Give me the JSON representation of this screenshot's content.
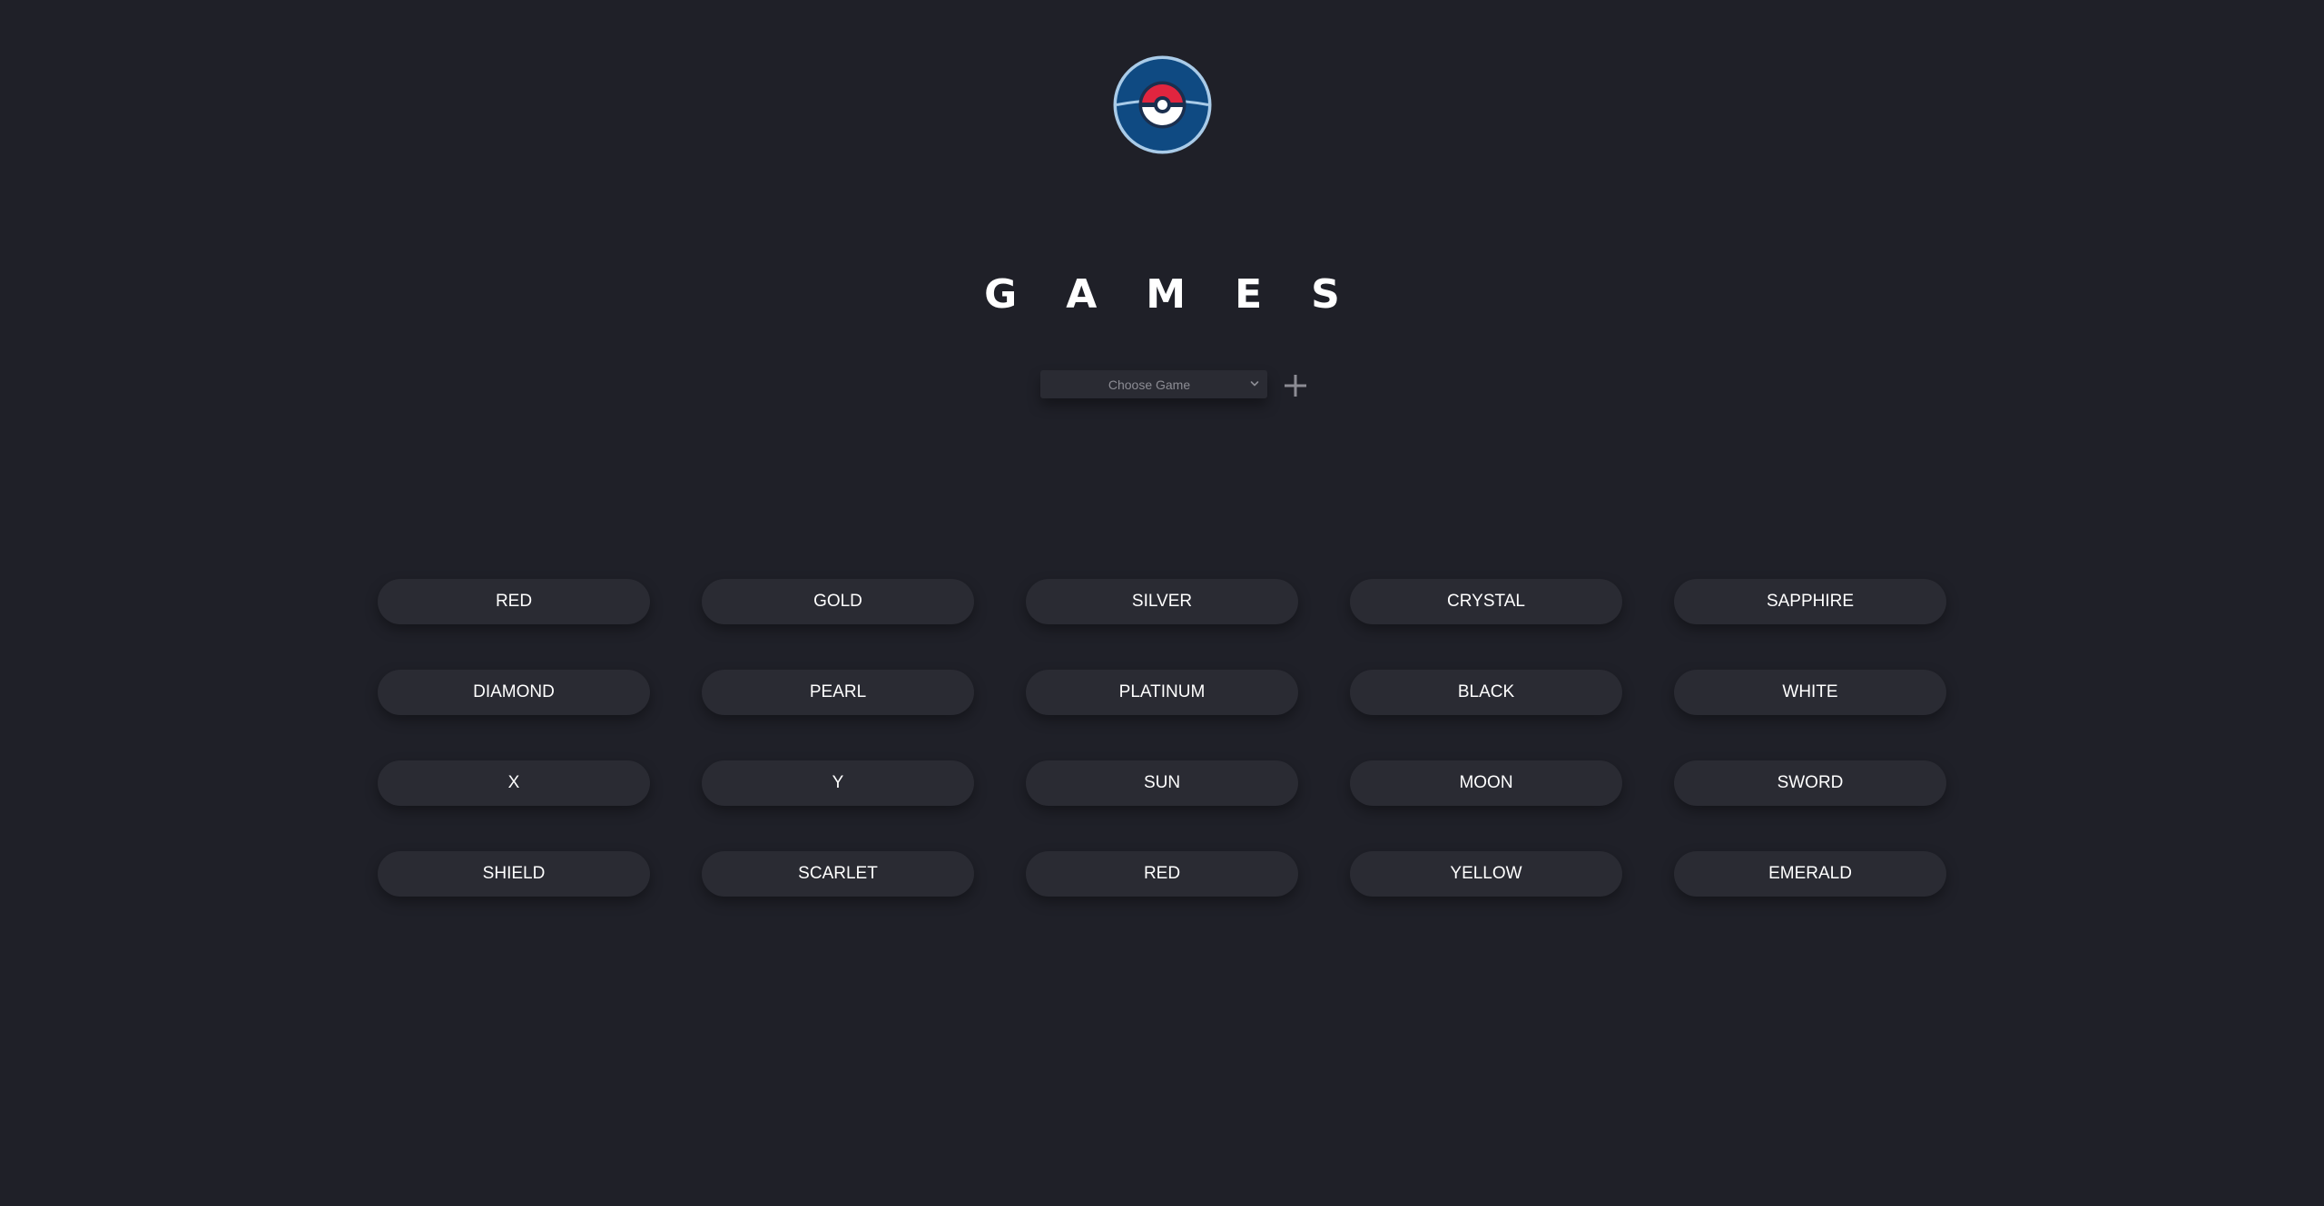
{
  "logo": {
    "icon": "pokeball-icon",
    "colors": {
      "outer": "#0f4a82",
      "ring": "#a9cbe8",
      "red": "#e1253f",
      "white": "#ffffff",
      "line": "#1b2f4e"
    }
  },
  "page": {
    "title": "GAMES",
    "background": "#1f2028",
    "button_background": "#2a2b33"
  },
  "controls": {
    "select": {
      "placeholder": "Choose Game",
      "icon": "chevron-down-icon"
    },
    "add": {
      "icon": "plus-icon"
    }
  },
  "games": [
    "RED",
    "GOLD",
    "SILVER",
    "CRYSTAL",
    "SAPPHIRE",
    "DIAMOND",
    "PEARL",
    "PLATINUM",
    "BLACK",
    "WHITE",
    "X",
    "Y",
    "SUN",
    "MOON",
    "SWORD",
    "SHIELD",
    "SCARLET",
    "RED",
    "YELLOW",
    "EMERALD"
  ]
}
